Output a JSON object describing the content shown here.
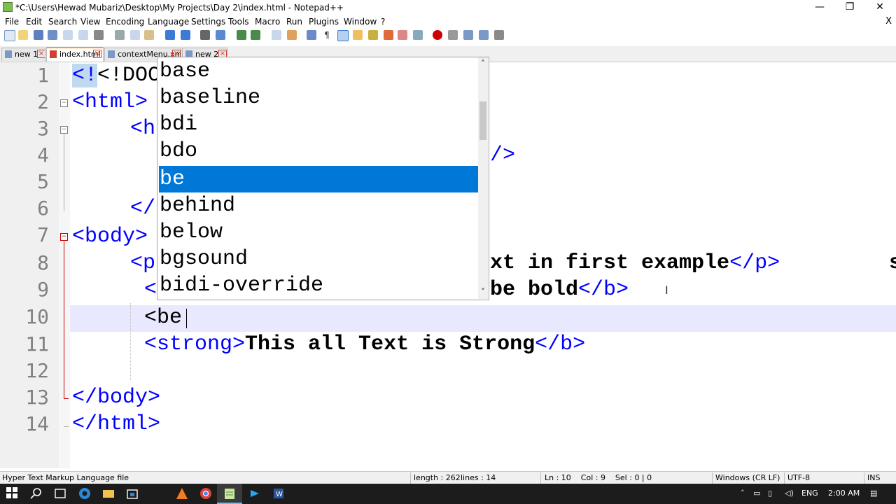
{
  "window": {
    "title": "*C:\\Users\\Hewad Mubariz\\Desktop\\My Projects\\Day 2\\index.html - Notepad++",
    "minimize": "—",
    "restore": "❐",
    "close": "✕"
  },
  "menu": {
    "items": [
      "File",
      "Edit",
      "Search",
      "View",
      "Encoding",
      "Language",
      "Settings",
      "Tools",
      "Macro",
      "Run",
      "Plugins",
      "Window",
      "?"
    ],
    "close_doc": "X"
  },
  "tabs": [
    {
      "label": "new 1",
      "icon_color": "#7a98c8"
    },
    {
      "label": "index.html",
      "icon_color": "#d04030"
    },
    {
      "label": "contextMenu.xml",
      "icon_color": "#7a98c8"
    },
    {
      "label": "new 2",
      "icon_color": "#7a98c8"
    }
  ],
  "editor": {
    "line_numbers": [
      "1",
      "2",
      "3",
      "4",
      "5",
      "6",
      "7",
      "8",
      "9",
      "10",
      "11",
      "12",
      "13",
      "14"
    ],
    "lines": {
      "l1": "<!DOCT",
      "l2": "<html>",
      "l3": "<h",
      "l4_tail": "/>",
      "l6": "</",
      "l7": "<body>",
      "l8_head": "<p",
      "l8_text": "xt in first example",
      "l8_close": "</p>",
      "l8_far": "s",
      "l9_head": "<",
      "l9_text": "be bold",
      "l9_close": "</b>",
      "l10": "<be",
      "l11_open": "<strong>",
      "l11_text": "This all Text is Strong",
      "l11_close": "</b>",
      "l13": "</body>",
      "l14": "</html>"
    }
  },
  "autocomplete": {
    "items": [
      "base",
      "baseline",
      "bdi",
      "bdo",
      "be",
      "behind",
      "below",
      "bgsound",
      "bidi-override"
    ],
    "selected_index": 4,
    "up_arrow": "˄",
    "down_arrow": "˅"
  },
  "status": {
    "file_type": "Hyper Text Markup Language file",
    "length": "length : 262",
    "lines": "lines : 14",
    "position": "Ln : 10    Col : 9    Sel : 0 | 0",
    "eol": "Windows (CR LF)",
    "encoding": "UTF-8",
    "mode": "INS"
  },
  "taskbar": {
    "language": "ENG",
    "time": "2:00 AM"
  },
  "colors": {
    "tag": "#0000ff",
    "selection": "#0078d7",
    "current_line": "#e8e8ff"
  }
}
